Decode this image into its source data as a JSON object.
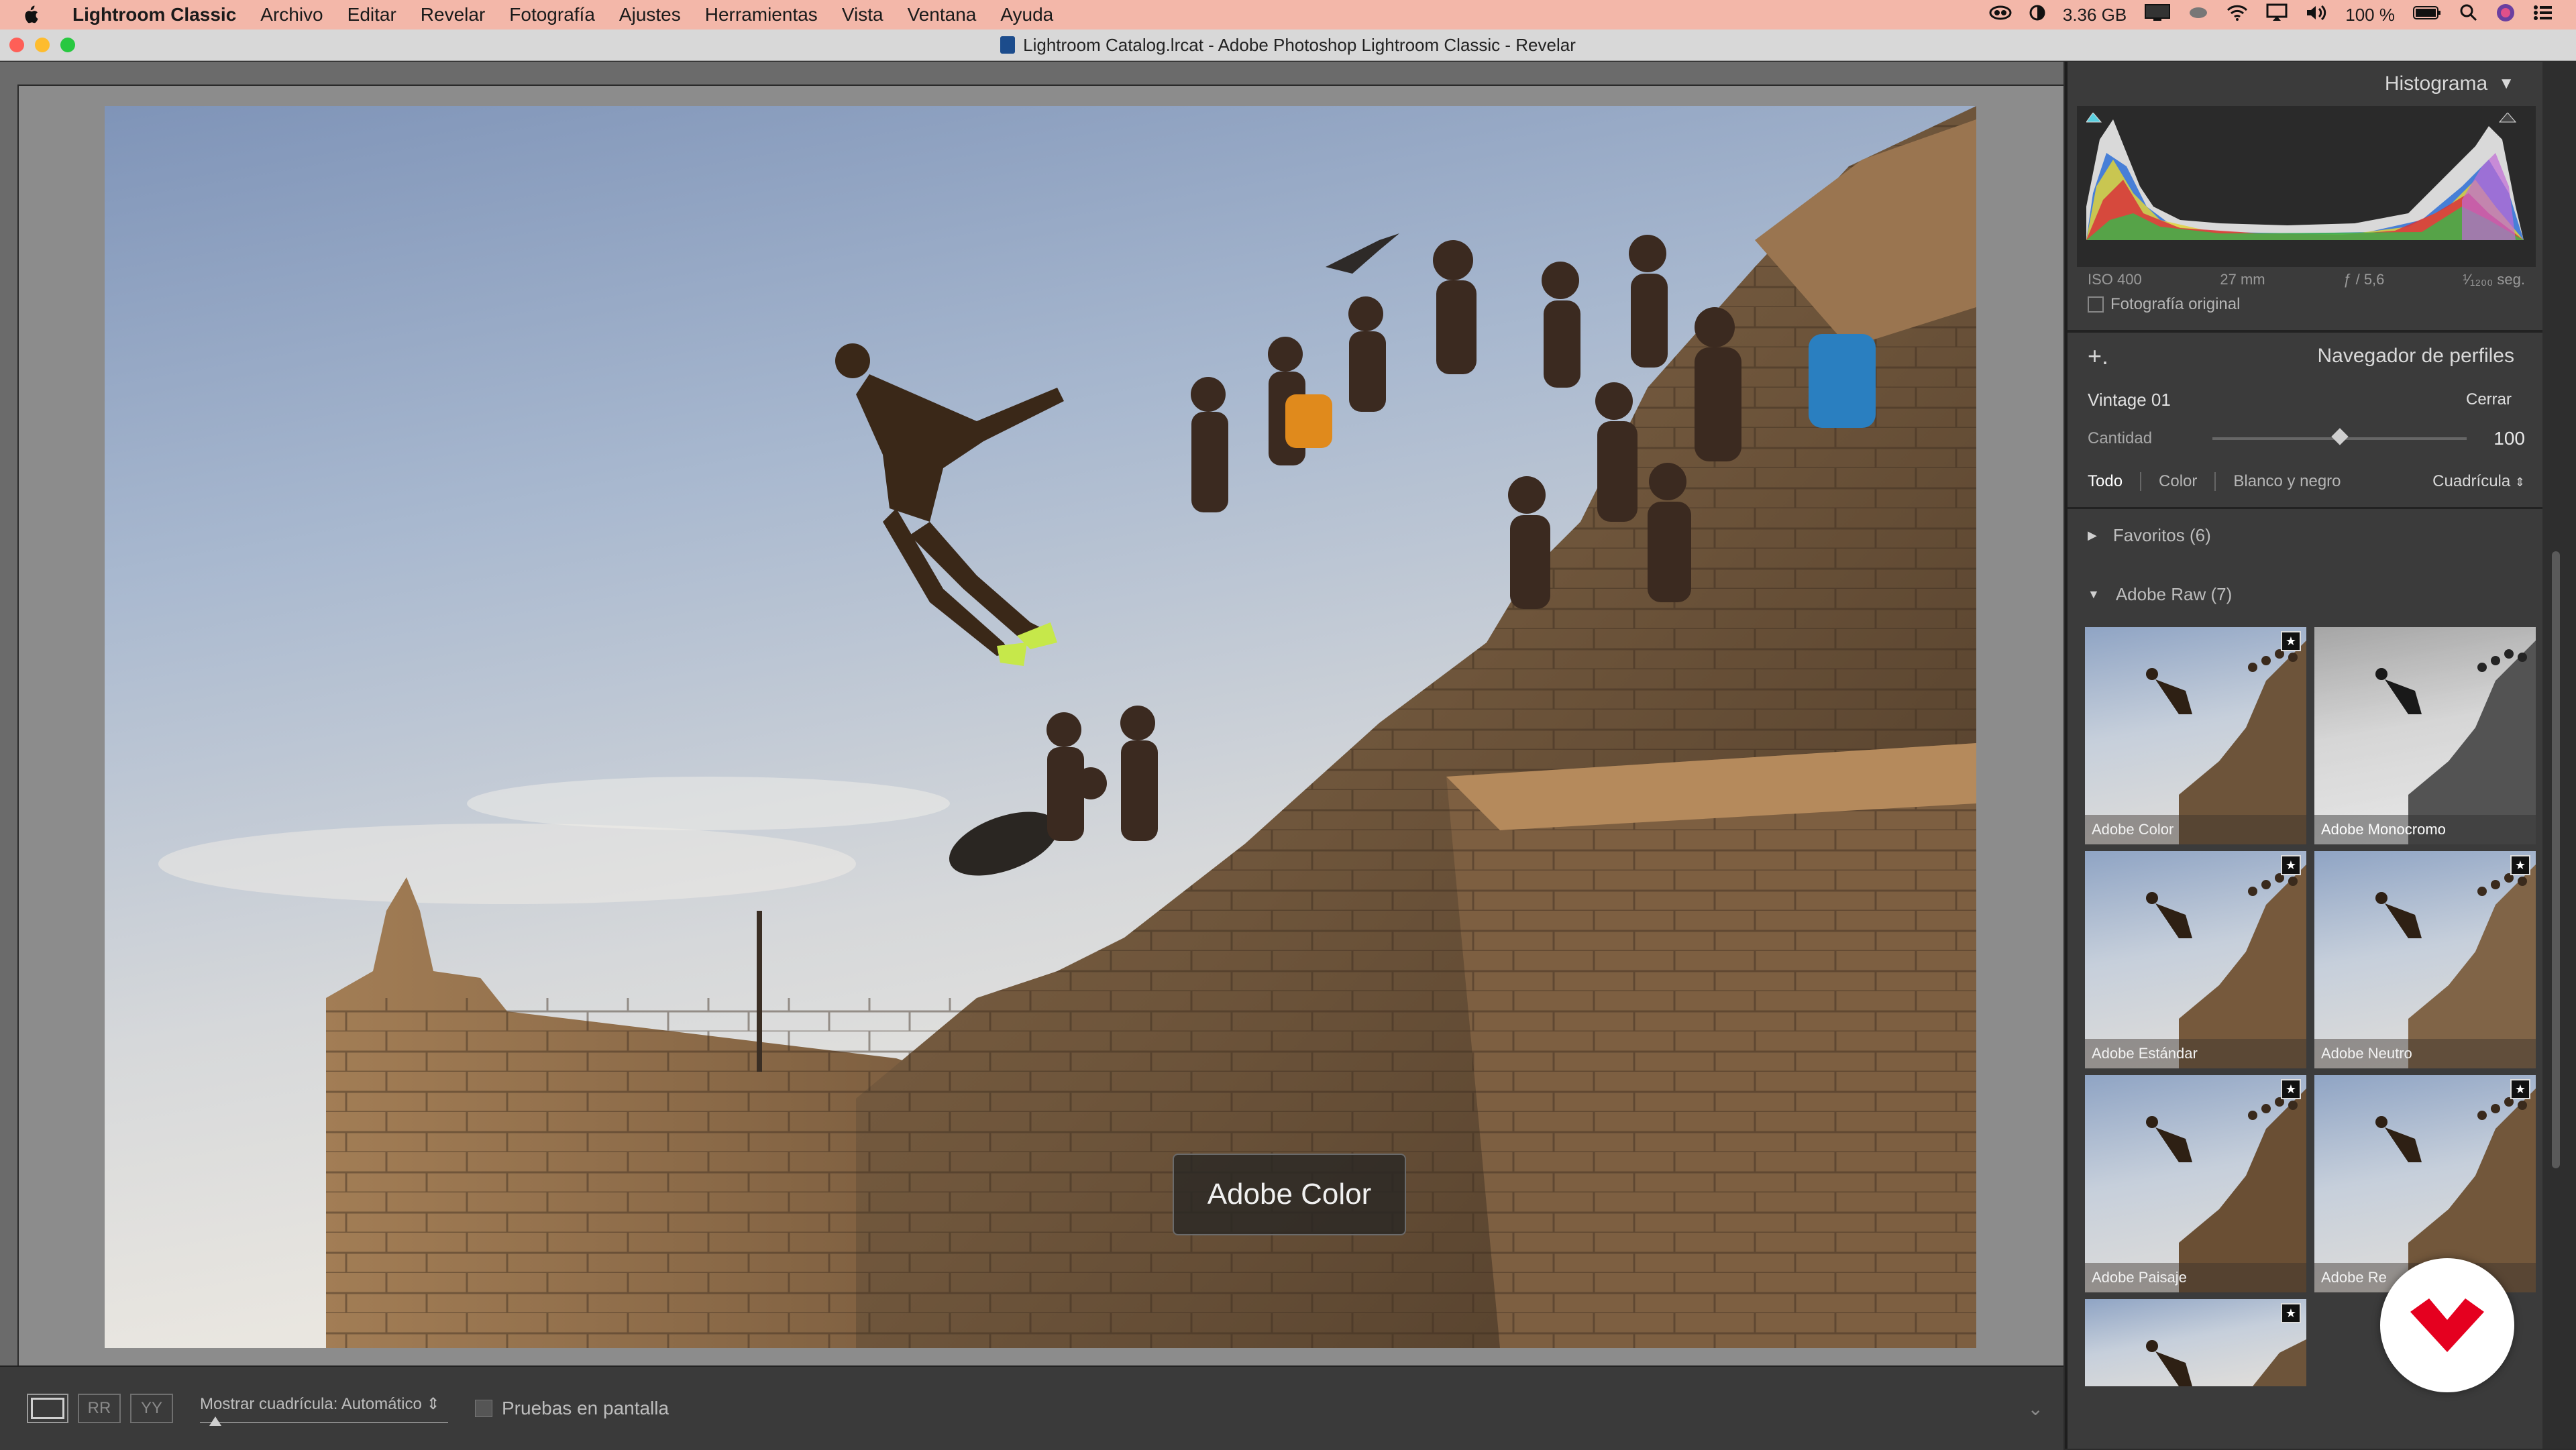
{
  "menubar": {
    "app_name": "Lightroom Classic",
    "items": [
      "Archivo",
      "Editar",
      "Revelar",
      "Fotografía",
      "Ajustes",
      "Herramientas",
      "Vista",
      "Ventana",
      "Ayuda"
    ],
    "memory": "3.36 GB",
    "battery": "100 %"
  },
  "window": {
    "title": "Lightroom Catalog.lrcat - Adobe Photoshop Lightroom Classic - Revelar"
  },
  "image": {
    "overlay_label": "Adobe Color"
  },
  "toolbar": {
    "grid_label": "Mostrar cuadrícula:",
    "grid_value": "Automático",
    "proof_label": "Pruebas en pantalla"
  },
  "histogram": {
    "title": "Histograma",
    "iso": "ISO 400",
    "focal": "27 mm",
    "aperture": "ƒ / 5,6",
    "shutter": "¹⁄₁₂₀₀ seg.",
    "original_label": "Fotografía original"
  },
  "profile_browser": {
    "title": "Navegador de perfiles",
    "current_profile": "Vintage 01",
    "close_label": "Cerrar",
    "amount_label": "Cantidad",
    "amount_value": "100",
    "amount_fraction": 0.5,
    "filters": {
      "all": "Todo",
      "color": "Color",
      "bw": "Blanco y negro",
      "view": "Cuadrícula"
    },
    "favorites": "Favoritos (6)",
    "adobe_raw": "Adobe Raw (7)",
    "profiles": [
      "Adobe Color",
      "Adobe Monocromo",
      "Adobe Estándar",
      "Adobe Neutro",
      "Adobe Paisaje",
      "Adobe Re"
    ]
  },
  "colors": {
    "menubar_bg": "#f3b7a9",
    "panel_bg": "#3b3b3b",
    "brand_red": "#e5001f"
  }
}
